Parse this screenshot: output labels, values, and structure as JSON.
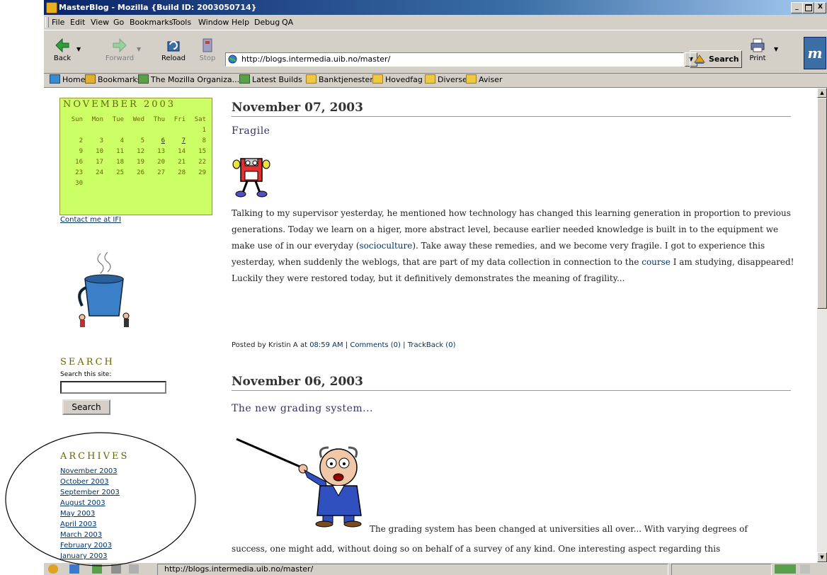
{
  "window": {
    "title": "MasterBlog - Mozilla {Build ID: 2003050714}",
    "controls": [
      "_",
      "·",
      "X"
    ]
  },
  "menu": [
    "File",
    "Edit",
    "View",
    "Go",
    "Bookmarks",
    "Tools",
    "Window",
    "Help",
    "Debug",
    "QA"
  ],
  "nav": {
    "back": "Back",
    "forward": "Forward",
    "reload": "Reload",
    "stop": "Stop",
    "url": "http://blogs.intermedia.uib.no/master/",
    "search": "Search",
    "print": "Print"
  },
  "bookmarks": [
    "Home",
    "Bookmarks",
    "The Mozilla Organiza...",
    "Latest Builds",
    "Banktjenester",
    "Hovedfag",
    "Diverse",
    "Aviser"
  ],
  "sidebar": {
    "calendar": {
      "caption": "NOVEMBER 2003",
      "weekdays": [
        "Sun",
        "Mon",
        "Tue",
        "Wed",
        "Thu",
        "Fri",
        "Sat"
      ],
      "weeks": [
        [
          "",
          "",
          "",
          "",
          "",
          "",
          "1"
        ],
        [
          "2",
          "3",
          "4",
          "5",
          "6",
          "7",
          "8"
        ],
        [
          "9",
          "10",
          "11",
          "12",
          "13",
          "14",
          "15"
        ],
        [
          "16",
          "17",
          "18",
          "19",
          "20",
          "21",
          "22"
        ],
        [
          "23",
          "24",
          "25",
          "26",
          "27",
          "28",
          "29"
        ],
        [
          "30",
          "",
          "",
          "",
          "",
          "",
          ""
        ]
      ],
      "linked_days": [
        "6",
        "7"
      ]
    },
    "contact": "Contact me at IFI",
    "search_heading": "SEARCH",
    "search_label": "Search this site:",
    "search_value": "",
    "search_button": "Search",
    "archives_heading": "ARCHIVES",
    "archives": [
      "November 2003",
      "October 2003",
      "September 2003",
      "August 2003",
      "May 2003",
      "April 2003",
      "March 2003",
      "February 2003",
      "January 2003"
    ]
  },
  "posts": [
    {
      "date": "November 07, 2003",
      "title": "Fragile",
      "body": [
        {
          "t": "Talking to my supervisor yesterday, he mentioned how technology has changed this learning generation in proportion to previous generations. Today we learn on a higer, more abstract level, because earlier needed knowledge is built in to the equipment we make use of in our everyday ("
        },
        {
          "a": "socioculture"
        },
        {
          "t": "). Take away these remedies, and we become very fragile. I got to experience this yesterday, when suddenly the weblogs, that are part of my data collection in connection to the "
        },
        {
          "a": "course"
        },
        {
          "t": " I am studying, disappeared! Luckily they were restored today, but it definitively demonstrates the meaning of fragility..."
        }
      ],
      "posted_prefix": "Posted by Kristin A at",
      "time": "08:59 AM",
      "comments": "Comments (0)",
      "trackback": "TrackBack (0)"
    },
    {
      "date": "November 06, 2003",
      "title": "The new grading system...",
      "body_line1": "The grading system has been changed at universities all over... With varying degrees of",
      "body_line2": "success, one might add, without doing so on behalf of a survey of any kind. One interesting aspect regarding this"
    }
  ],
  "status": {
    "text": "http://blogs.intermedia.uib.no/master/"
  },
  "colors": {
    "titlebar": "#0a246a",
    "calendar_bg": "#ccff66",
    "heading_olive": "#666600",
    "link": "#003366",
    "post_title": "#333366"
  }
}
